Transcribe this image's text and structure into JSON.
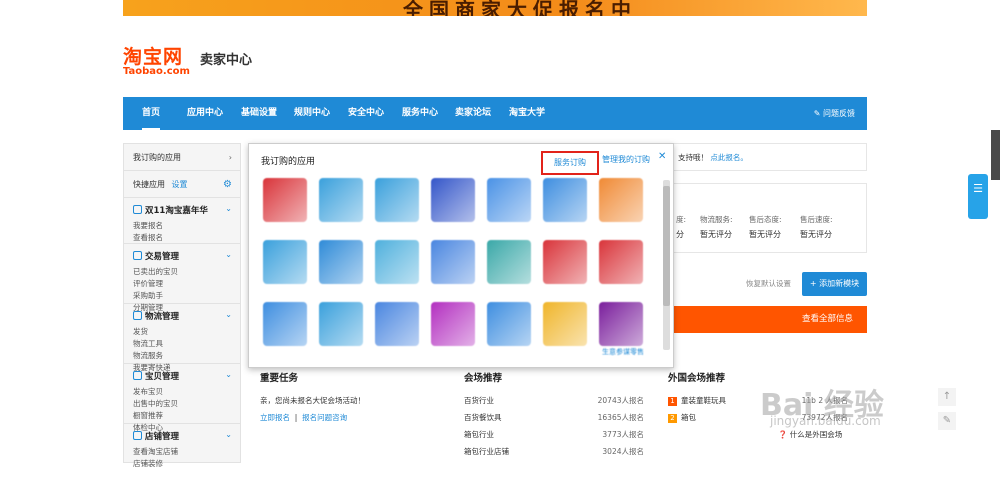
{
  "banner": {
    "text": "全国商家大促报名中"
  },
  "logo": {
    "cn": "淘宝网",
    "en": "Taobao.com"
  },
  "header": {
    "title": "卖家中心"
  },
  "nav": {
    "items": [
      "首页",
      "应用中心",
      "基础设置",
      "规则中心",
      "安全中心",
      "服务中心",
      "卖家论坛",
      "淘宝大学"
    ],
    "feedback": "问题反馈"
  },
  "sidebar": {
    "my_apps": "我订购的应用",
    "quick_apps": "快捷应用",
    "settings": "设置",
    "sections": [
      {
        "title": "双11淘宝嘉年华",
        "links": [
          "我要报名",
          "查看报名"
        ]
      },
      {
        "title": "交易管理",
        "links": [
          "已卖出的宝贝",
          "评价管理",
          "采购助手",
          "分期管理"
        ]
      },
      {
        "title": "物流管理",
        "links": [
          "发货",
          "物流工具",
          "物流服务",
          "我要寄快递"
        ]
      },
      {
        "title": "宝贝管理",
        "links": [
          "发布宝贝",
          "出售中的宝贝",
          "橱窗推荐",
          "体检中心"
        ]
      },
      {
        "title": "店铺管理",
        "links": [
          "查看淘宝店铺",
          "店铺装修"
        ]
      }
    ]
  },
  "popup": {
    "title": "我订购的应用",
    "service_order": "服务订购",
    "manage": "管理我的订购",
    "close": "✕",
    "apps": [
      {
        "color": "#d9343a",
        "label": ""
      },
      {
        "color": "#3aa0dc",
        "label": ""
      },
      {
        "color": "#3aa0dc",
        "label": ""
      },
      {
        "color": "#3456c9",
        "label": ""
      },
      {
        "color": "#4a92e6",
        "label": ""
      },
      {
        "color": "#3e8ee0",
        "label": ""
      },
      {
        "color": "#f08a35",
        "label": ""
      },
      {
        "color": "#3aa0dc",
        "label": ""
      },
      {
        "color": "#2f8bd8",
        "label": ""
      },
      {
        "color": "#4fb0dd",
        "label": ""
      },
      {
        "color": "#4a86e0",
        "label": ""
      },
      {
        "color": "#3aa8a8",
        "label": ""
      },
      {
        "color": "#d9343a",
        "label": ""
      },
      {
        "color": "#d9343a",
        "label": ""
      },
      {
        "color": "#3e8ee0",
        "label": ""
      },
      {
        "color": "#3aa0dc",
        "label": ""
      },
      {
        "color": "#4a86e0",
        "label": ""
      },
      {
        "color": "#b32fc0",
        "label": ""
      },
      {
        "color": "#3e8ee0",
        "label": ""
      },
      {
        "color": "#f0b52a",
        "label": ""
      },
      {
        "color": "#7a1e9c",
        "label": "生意参谋零售"
      }
    ]
  },
  "right_top": {
    "prefix": "支持哦！",
    "link": "点此报名。"
  },
  "ratings": [
    {
      "label": "度:",
      "value": "分"
    },
    {
      "label": "物流服务:",
      "value": "暂无评分"
    },
    {
      "label": "售后态度:",
      "value": "暂无评分"
    },
    {
      "label": "售后速度:",
      "value": "暂无评分"
    }
  ],
  "modules": {
    "restore": "恢复默认设置",
    "add": "+ 添加新模块",
    "view_all": "查看全部信息"
  },
  "tasks": {
    "title": "重要任务",
    "msg": "亲，您尚未报名大促会场活动！",
    "link1": "立即报名",
    "link2": "报名问题咨询"
  },
  "venue": {
    "title": "会场推荐",
    "rows": [
      {
        "name": "百货行业",
        "count": "20743人报名"
      },
      {
        "name": "百货餐饮具",
        "count": "16365人报名"
      },
      {
        "name": "箱包行业",
        "count": "3773人报名"
      },
      {
        "name": "箱包行业店铺",
        "count": "3024人报名"
      }
    ]
  },
  "foreign": {
    "title": "外国会场推荐",
    "rows": [
      {
        "badge": "1",
        "name": "童装童鞋玩具",
        "count": "11b 2 人报名"
      },
      {
        "badge": "2",
        "name": "箱包",
        "count": "73972人报名"
      }
    ],
    "help": "什么是外国会场"
  },
  "watermark": {
    "main": "Bai 经验",
    "sub": "jingyan.baidu.com"
  },
  "colors": {
    "brand_blue": "#1f8ad6",
    "taobao_orange": "#ff4400",
    "highlight": "#e2231a"
  }
}
